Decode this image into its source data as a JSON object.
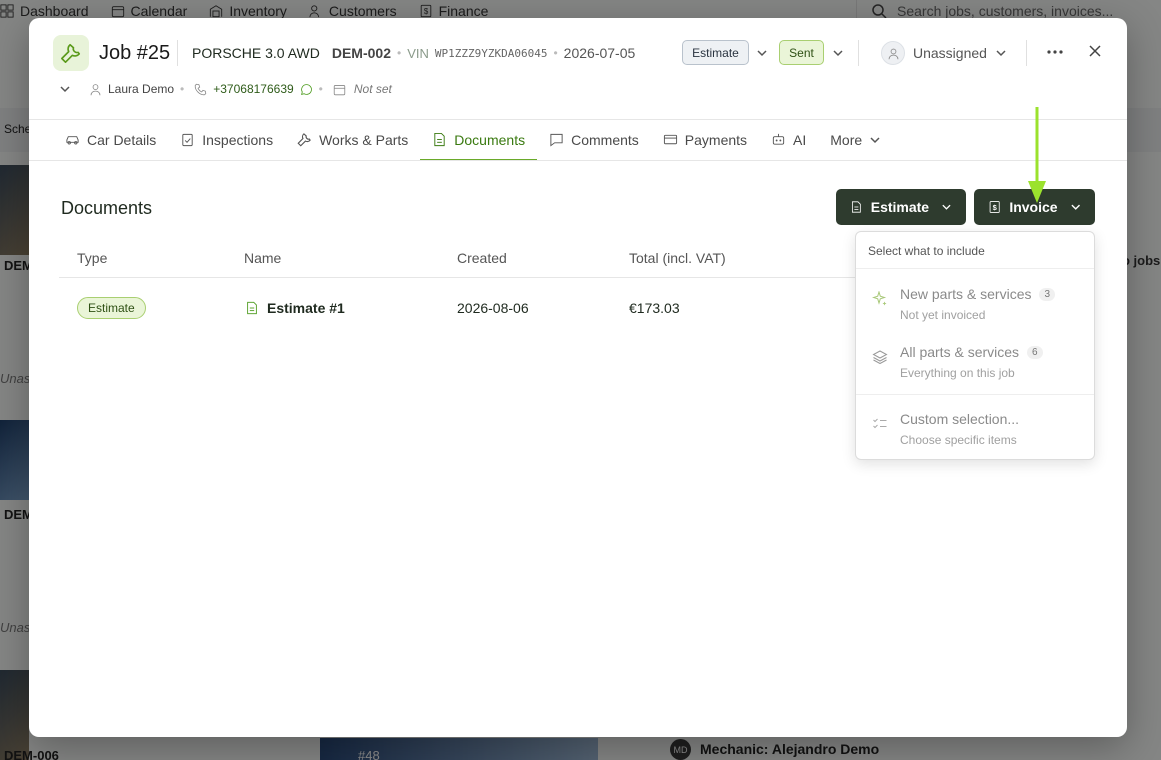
{
  "background": {
    "nav": [
      "Dashboard",
      "Calendar",
      "Inventory",
      "Customers",
      "Finance"
    ],
    "search_placeholder": "Search jobs, customers, invoices...",
    "fragments": {
      "sche": "Sche",
      "dem1": "DEM",
      "dem2": "DEM",
      "dem3": "DEM-006",
      "job48": "#48",
      "unas1": "Unas",
      "unas2": "Unas",
      "mechanic": "Mechanic: Alejandro Demo",
      "mechanic_initials": "MD",
      "no_jobs": "o jobs"
    }
  },
  "job": {
    "title": "Job #25",
    "car_model": "PORSCHE 3.0 AWD",
    "plate": "DEM-002",
    "vin_label": "VIN",
    "vin": "WP1ZZZ9YZKDA06045",
    "date": "2026-07-05",
    "status_estimate": "Estimate",
    "status_sent": "Sent",
    "assignee": "Unassigned",
    "customer": "Laura Demo",
    "phone": "+37068176639",
    "schedule": "Not set"
  },
  "tabs": [
    {
      "label": "Car Details",
      "icon": "car-icon"
    },
    {
      "label": "Inspections",
      "icon": "clipboard-check-icon"
    },
    {
      "label": "Works & Parts",
      "icon": "wrench-icon"
    },
    {
      "label": "Documents",
      "icon": "document-icon",
      "active": true
    },
    {
      "label": "Comments",
      "icon": "comment-icon"
    },
    {
      "label": "Payments",
      "icon": "credit-card-icon"
    },
    {
      "label": "AI",
      "icon": "robot-icon"
    },
    {
      "label": "More",
      "icon": "chevron-down-icon"
    }
  ],
  "documents": {
    "title": "Documents",
    "estimate_button": "Estimate",
    "invoice_button": "Invoice",
    "columns": [
      "Type",
      "Name",
      "Created",
      "Total (incl. VAT)"
    ],
    "rows": [
      {
        "type": "Estimate",
        "name": "Estimate #1",
        "created": "2026-08-06",
        "total": "€173.03"
      }
    ]
  },
  "invoice_menu": {
    "header": "Select what to include",
    "items": [
      {
        "label": "New parts & services",
        "count": "3",
        "desc": "Not yet invoiced",
        "icon": "sparkles-icon"
      },
      {
        "label": "All parts & services",
        "count": "6",
        "desc": "Everything on this job",
        "icon": "layers-icon"
      },
      {
        "label": "Custom selection...",
        "desc": "Choose specific items",
        "icon": "checklist-icon"
      }
    ]
  },
  "colors": {
    "accent_green": "#6aaa2a",
    "dark_button": "#2e3b2e",
    "arrow": "#9be22d"
  }
}
